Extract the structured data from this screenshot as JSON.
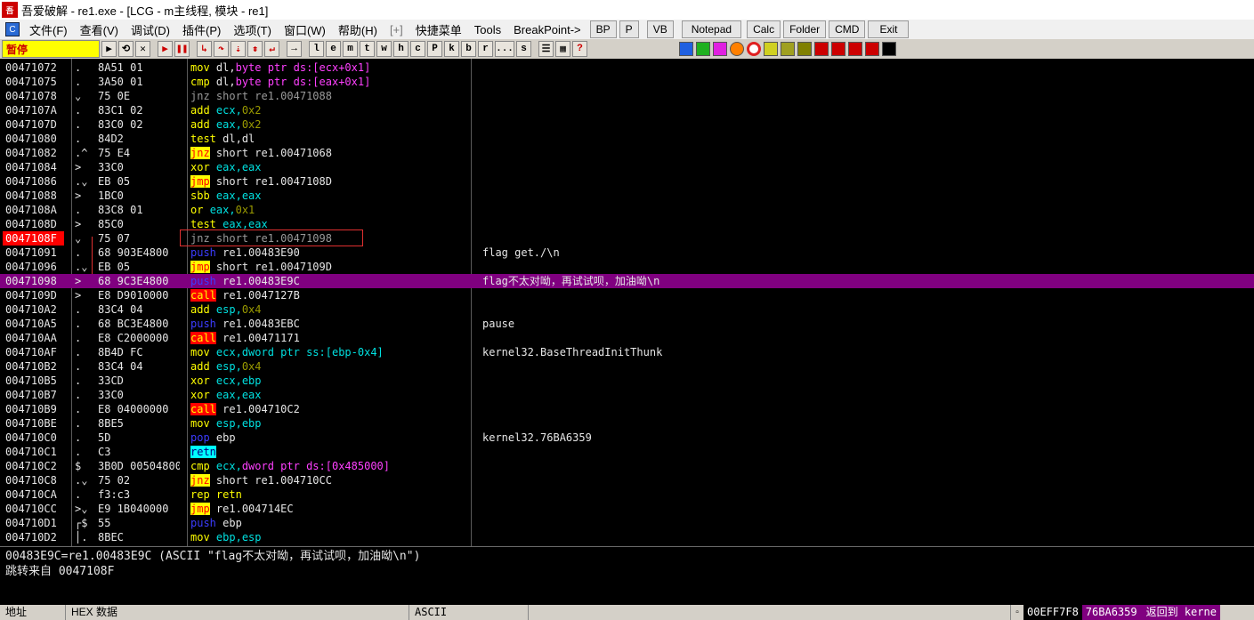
{
  "window": {
    "title": "吾爱破解 - re1.exe - [LCG - m主线程, 模块 - re1]",
    "logo_text": "吾"
  },
  "menu": [
    {
      "label": "文件(F)"
    },
    {
      "label": "查看(V)"
    },
    {
      "label": "调试(D)"
    },
    {
      "label": "插件(P)"
    },
    {
      "label": "选项(T)"
    },
    {
      "label": "窗口(W)"
    },
    {
      "label": "帮助(H)"
    },
    {
      "label": "[+]"
    },
    {
      "label": "快捷菜单"
    },
    {
      "label": "Tools"
    },
    {
      "label": "BreakPoint->"
    }
  ],
  "menu_buttons": [
    "BP",
    "P",
    "VB",
    "Notepad",
    "Calc",
    "Folder",
    "CMD",
    "Exit"
  ],
  "toolbar": {
    "status": "暂停",
    "letters": [
      "l",
      "e",
      "m",
      "t",
      "w",
      "h",
      "c",
      "P",
      "k",
      "b",
      "r",
      "...",
      "s"
    ]
  },
  "disasm": [
    {
      "addr": "00471072",
      "mark": ".",
      "hex": "8A51 01",
      "kind": "mov",
      "mn": "mov",
      "ops": [
        [
          "dl,",
          ""
        ],
        [
          "byte ptr ds:[ecx+0x1]",
          "ptr"
        ]
      ],
      "comment": ""
    },
    {
      "addr": "00471075",
      "mark": ".",
      "hex": "3A50 01",
      "kind": "mov",
      "mn": "cmp",
      "ops": [
        [
          "dl,",
          ""
        ],
        [
          "byte ptr ds:[eax+0x1]",
          "ptr"
        ]
      ],
      "comment": ""
    },
    {
      "addr": "00471078",
      "mark": "⌄",
      "hex": "75 0E",
      "kind": "dim",
      "mn": "jnz",
      "ops": [
        [
          "short re1.00471088",
          ""
        ]
      ],
      "comment": ""
    },
    {
      "addr": "0047107A",
      "mark": ".",
      "hex": "83C1 02",
      "kind": "mov",
      "mn": "add",
      "ops": [
        [
          "ecx,",
          "reg"
        ],
        [
          "0x2",
          "imm"
        ]
      ],
      "comment": ""
    },
    {
      "addr": "0047107D",
      "mark": ".",
      "hex": "83C0 02",
      "kind": "mov",
      "mn": "add",
      "ops": [
        [
          "eax,",
          "reg"
        ],
        [
          "0x2",
          "imm"
        ]
      ],
      "comment": ""
    },
    {
      "addr": "00471080",
      "mark": ".",
      "hex": "84D2",
      "kind": "mov",
      "mn": "test",
      "ops": [
        [
          "dl,dl",
          ""
        ]
      ],
      "comment": ""
    },
    {
      "addr": "00471082",
      "mark": ".^",
      "hex": "75 E4",
      "kind": "jcc-hl",
      "mn": "jnz",
      "ops": [
        [
          "short re1.00471068",
          ""
        ]
      ],
      "comment": ""
    },
    {
      "addr": "00471084",
      "mark": ">",
      "hex": "33C0",
      "kind": "mov",
      "mn": "xor",
      "ops": [
        [
          "eax,eax",
          "reg"
        ]
      ],
      "comment": ""
    },
    {
      "addr": "00471086",
      "mark": ".⌄",
      "hex": "EB 05",
      "kind": "jmp",
      "mn": "jmp",
      "ops": [
        [
          "short re1.0047108D",
          ""
        ]
      ],
      "comment": ""
    },
    {
      "addr": "00471088",
      "mark": ">",
      "hex": "1BC0",
      "kind": "mov",
      "mn": "sbb",
      "ops": [
        [
          "eax,eax",
          "reg"
        ]
      ],
      "comment": ""
    },
    {
      "addr": "0047108A",
      "mark": ".",
      "hex": "83C8 01",
      "kind": "mov",
      "mn": "or",
      "ops": [
        [
          "eax,",
          "reg"
        ],
        [
          "0x1",
          "imm"
        ]
      ],
      "comment": ""
    },
    {
      "addr": "0047108D",
      "mark": ">",
      "hex": "85C0",
      "kind": "mov",
      "mn": "test",
      "ops": [
        [
          "eax,eax",
          "reg"
        ]
      ],
      "comment": ""
    },
    {
      "addr": "0047108F",
      "mark": "⌄",
      "hex": "75 07",
      "kind": "dim",
      "mn": "jnz",
      "ops": [
        [
          "short re1.00471098",
          ""
        ]
      ],
      "comment": "",
      "bp": true
    },
    {
      "addr": "00471091",
      "mark": ".",
      "hex": "68 903E4800",
      "kind": "push",
      "mn": "push",
      "ops": [
        [
          "re1.00483E90",
          ""
        ]
      ],
      "comment": "flag get./\\n"
    },
    {
      "addr": "00471096",
      "mark": ".⌄",
      "hex": "EB 05",
      "kind": "jmp",
      "mn": "jmp",
      "ops": [
        [
          "short re1.0047109D",
          ""
        ]
      ],
      "comment": ""
    },
    {
      "addr": "00471098",
      "mark": ">",
      "hex": "68 9C3E4800",
      "kind": "push",
      "mn": "push",
      "ops": [
        [
          "re1.00483E9C",
          ""
        ]
      ],
      "comment": "flag不太对呦，再试试呗，加油呦\\n",
      "sel": true
    },
    {
      "addr": "0047109D",
      "mark": ">",
      "hex": "E8 D9010000",
      "kind": "call",
      "mn": "call",
      "ops": [
        [
          "re1.0047127B",
          ""
        ]
      ],
      "comment": ""
    },
    {
      "addr": "004710A2",
      "mark": ".",
      "hex": "83C4 04",
      "kind": "mov",
      "mn": "add",
      "ops": [
        [
          "esp,",
          "reg"
        ],
        [
          "0x4",
          "imm"
        ]
      ],
      "comment": ""
    },
    {
      "addr": "004710A5",
      "mark": ".",
      "hex": "68 BC3E4800",
      "kind": "push",
      "mn": "push",
      "ops": [
        [
          "re1.00483EBC",
          ""
        ]
      ],
      "comment": "pause"
    },
    {
      "addr": "004710AA",
      "mark": ".",
      "hex": "E8 C2000000",
      "kind": "call",
      "mn": "call",
      "ops": [
        [
          "re1.00471171",
          ""
        ]
      ],
      "comment": ""
    },
    {
      "addr": "004710AF",
      "mark": ".",
      "hex": "8B4D FC",
      "kind": "mov",
      "mn": "mov",
      "ops": [
        [
          "ecx,",
          "reg"
        ],
        [
          "dword ptr ss:[ebp-0x4]",
          "ptrc"
        ]
      ],
      "comment": "kernel32.BaseThreadInitThunk"
    },
    {
      "addr": "004710B2",
      "mark": ".",
      "hex": "83C4 04",
      "kind": "mov",
      "mn": "add",
      "ops": [
        [
          "esp,",
          "reg"
        ],
        [
          "0x4",
          "imm"
        ]
      ],
      "comment": ""
    },
    {
      "addr": "004710B5",
      "mark": ".",
      "hex": "33CD",
      "kind": "mov",
      "mn": "xor",
      "ops": [
        [
          "ecx,ebp",
          "reg"
        ]
      ],
      "comment": ""
    },
    {
      "addr": "004710B7",
      "mark": ".",
      "hex": "33C0",
      "kind": "mov",
      "mn": "xor",
      "ops": [
        [
          "eax,eax",
          "reg"
        ]
      ],
      "comment": ""
    },
    {
      "addr": "004710B9",
      "mark": ".",
      "hex": "E8 04000000",
      "kind": "call",
      "mn": "call",
      "ops": [
        [
          "re1.004710C2",
          ""
        ]
      ],
      "comment": ""
    },
    {
      "addr": "004710BE",
      "mark": ".",
      "hex": "8BE5",
      "kind": "mov",
      "mn": "mov",
      "ops": [
        [
          "esp,ebp",
          "reg"
        ]
      ],
      "comment": ""
    },
    {
      "addr": "004710C0",
      "mark": ".",
      "hex": "5D",
      "kind": "push",
      "mn": "pop",
      "ops": [
        [
          "ebp",
          ""
        ]
      ],
      "comment": "kernel32.76BA6359"
    },
    {
      "addr": "004710C1",
      "mark": ".",
      "hex": "C3",
      "kind": "ret",
      "mn": "retn",
      "ops": [],
      "comment": ""
    },
    {
      "addr": "004710C2",
      "mark": "$",
      "hex": "3B0D 00504800",
      "kind": "mov",
      "mn": "cmp",
      "ops": [
        [
          "ecx,",
          "reg"
        ],
        [
          "dword ptr ds:[0x485000]",
          "ptr"
        ]
      ],
      "comment": ""
    },
    {
      "addr": "004710C8",
      "mark": ".⌄",
      "hex": "75 02",
      "kind": "jcc-hl",
      "mn": "jnz",
      "ops": [
        [
          "short re1.004710CC",
          ""
        ]
      ],
      "comment": ""
    },
    {
      "addr": "004710CA",
      "mark": ".",
      "hex": "f3:c3",
      "kind": "mov",
      "mn": "rep retn",
      "ops": [],
      "comment": ""
    },
    {
      "addr": "004710CC",
      "mark": ">⌄",
      "hex": "E9 1B040000",
      "kind": "jmp",
      "mn": "jmp",
      "ops": [
        [
          "re1.004714EC",
          ""
        ]
      ],
      "comment": ""
    },
    {
      "addr": "004710D1",
      "mark": "┌$",
      "hex": "55",
      "kind": "push",
      "mn": "push",
      "ops": [
        [
          "ebp",
          ""
        ]
      ],
      "comment": ""
    },
    {
      "addr": "004710D2",
      "mark": "│.",
      "hex": "8BEC",
      "kind": "mov",
      "mn": "mov",
      "ops": [
        [
          "ebp,esp",
          "reg"
        ]
      ],
      "comment": ""
    }
  ],
  "info": {
    "line1": "00483E9C=re1.00483E9C (ASCII \"flag不太对呦，再试试呗，加油呦\\n\")",
    "line2": "跳转来自 0047108F"
  },
  "bottom": {
    "addr_header": "地址",
    "hex_header": "HEX 数据",
    "ascii_header": "ASCII",
    "stack_addr": "00EFF7F8",
    "stack_val": "76BA6359",
    "stack_cmt": "返回到 kerne"
  }
}
